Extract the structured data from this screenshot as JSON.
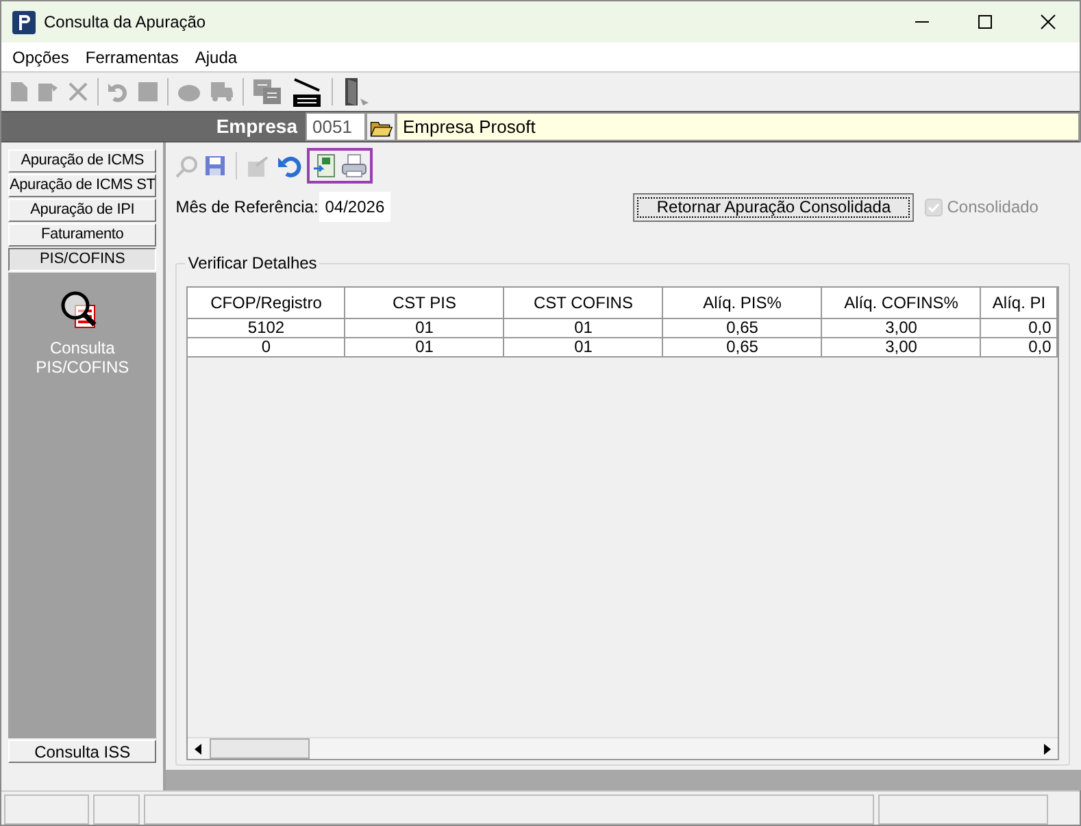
{
  "window": {
    "title": "Consulta da Apuração"
  },
  "menu": [
    "Opções",
    "Ferramentas",
    "Ajuda"
  ],
  "empresa": {
    "label": "Empresa",
    "code": "0051",
    "name": "Empresa Prosoft"
  },
  "sidebar": {
    "items": [
      {
        "label": "Apuração de ICMS",
        "selected": false
      },
      {
        "label": "Apuração de ICMS ST",
        "selected": false
      },
      {
        "label": "Apuração de IPI",
        "selected": false
      },
      {
        "label": "Faturamento",
        "selected": false
      },
      {
        "label": "PIS/COFINS",
        "selected": true
      }
    ],
    "panel_item": "Consulta PIS/COFINS",
    "bottom_item": "Consulta ISS"
  },
  "month": {
    "label": "Mês de Referência:",
    "value": "04/2026"
  },
  "return_button": "Retornar Apuração Consolidada",
  "consolidado": {
    "label": "Consolidado",
    "checked": true,
    "disabled": true
  },
  "group_title": "Verificar Detalhes",
  "table": {
    "columns": [
      "CFOP/Registro",
      "CST PIS",
      "CST COFINS",
      "Alíq. PIS%",
      "Alíq. COFINS%",
      "Alíq. PI"
    ],
    "rows": [
      [
        "5102",
        "01",
        "01",
        "0,65",
        "3,00",
        "0,0"
      ],
      [
        "0",
        "01",
        "01",
        "0,65",
        "3,00",
        "0,0"
      ]
    ]
  }
}
